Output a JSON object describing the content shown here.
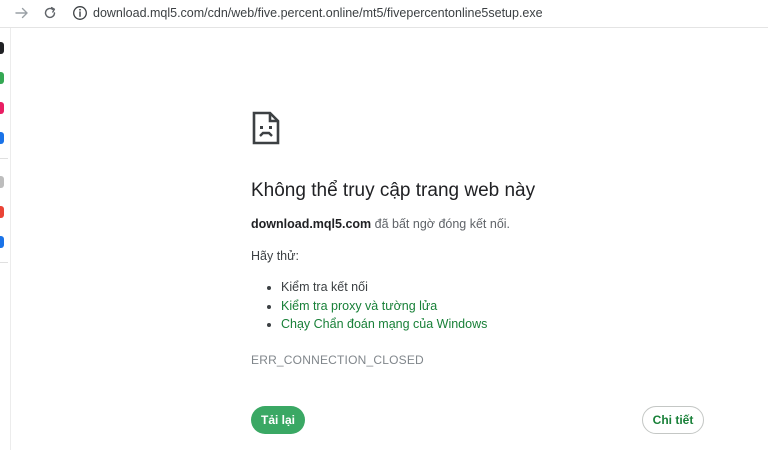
{
  "toolbar": {
    "url": "download.mql5.com/cdn/web/five.percent.online/mt5/fivepercentonline5setup.exe",
    "forward_icon": "arrow-right",
    "reload_icon": "reload",
    "site_info_icon": "info-circle"
  },
  "sidebar": {
    "icon_colors": [
      "#202124",
      "#34a853",
      "#e91e63",
      "#1a73e8",
      "#bdbdbd",
      "#ea4335",
      "#1a73e8"
    ]
  },
  "error": {
    "icon": "sad-page",
    "title": "Không thể truy cập trang web này",
    "host": "download.mql5.com",
    "message": "đã bất ngờ đóng kết nối.",
    "try_label": "Hãy thử:",
    "suggestions": [
      "Kiểm tra kết nối",
      "Kiểm tra proxy và tường lửa",
      "Chạy Chẩn đoán mạng của Windows"
    ],
    "code": "ERR_CONNECTION_CLOSED",
    "reload_button": "Tải lại",
    "details_button": "Chi tiết"
  },
  "colors": {
    "accent": "#3aa864",
    "link": "#188038",
    "title": "#202124",
    "muted": "#80868b"
  }
}
